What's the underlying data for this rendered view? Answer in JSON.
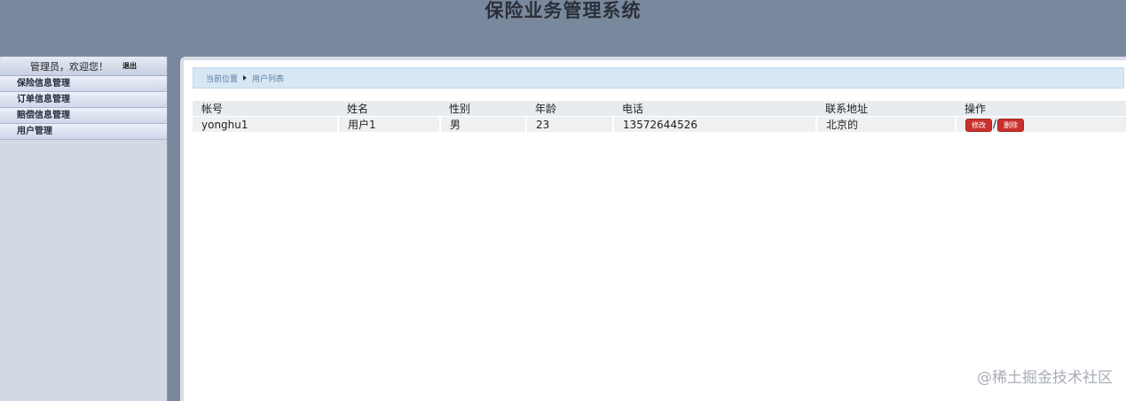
{
  "app": {
    "title": "保险业务管理系统"
  },
  "sidebar": {
    "welcome": "管理员，欢迎您！",
    "logout": "退出",
    "items": [
      {
        "label": "保险信息管理"
      },
      {
        "label": "订单信息管理"
      },
      {
        "label": "赔偿信息管理"
      },
      {
        "label": "用户管理"
      }
    ]
  },
  "breadcrumb": {
    "current_label": "当前位置",
    "page": "用户列表"
  },
  "table": {
    "headers": [
      "帐号",
      "姓名",
      "性别",
      "年龄",
      "电话",
      "联系地址",
      "操作"
    ],
    "rows": [
      {
        "account": "yonghu1",
        "name": "用户1",
        "gender": "男",
        "age": "23",
        "phone": "13572644526",
        "address": "北京的",
        "edit": "修改",
        "sep": "/",
        "delete": "删除"
      }
    ]
  },
  "watermark": "@稀土掘金技术社区"
}
